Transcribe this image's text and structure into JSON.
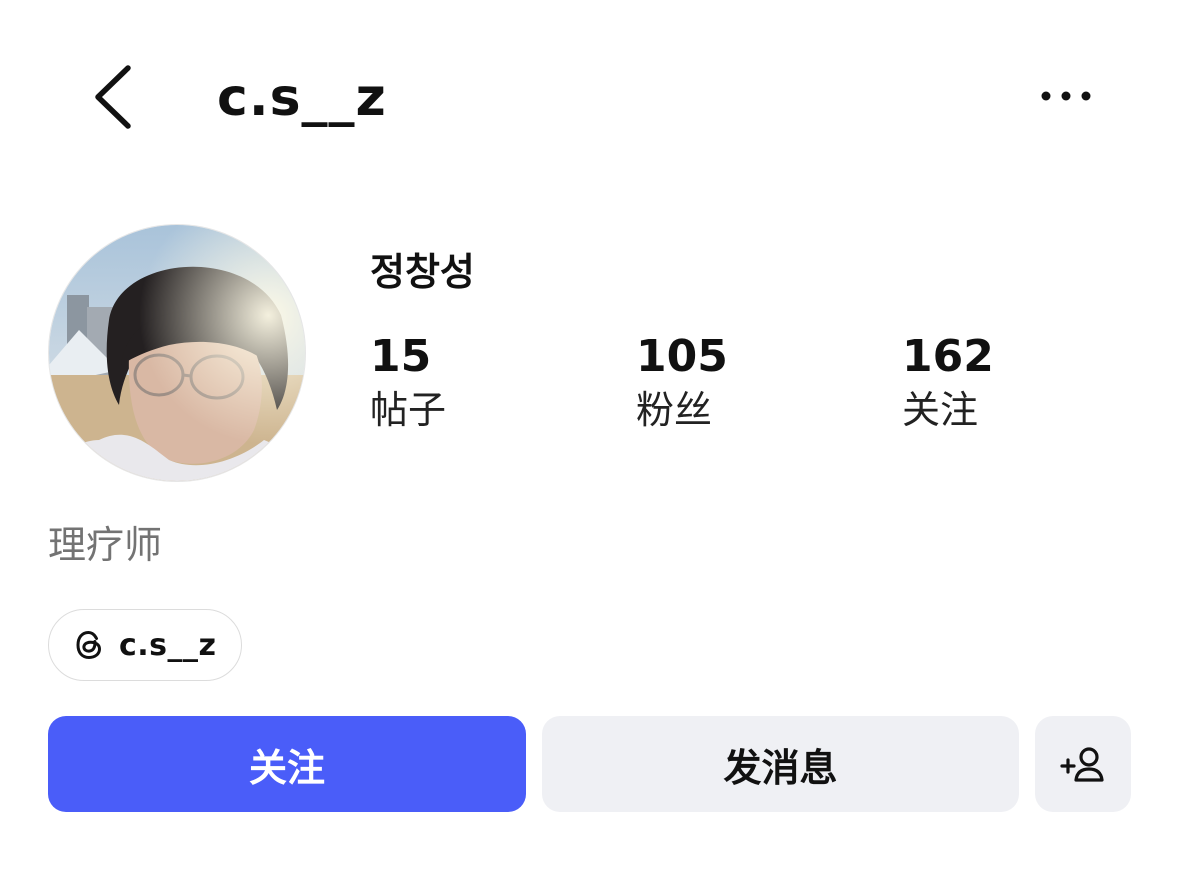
{
  "header": {
    "username": "c.s__z",
    "back_icon": "chevron-left-icon",
    "more_icon": "more-horizontal-icon"
  },
  "profile": {
    "display_name": "정창성",
    "avatar": "profile-photo"
  },
  "stats": {
    "posts": {
      "value": "15",
      "label": "帖子"
    },
    "followers": {
      "value": "105",
      "label": "粉丝"
    },
    "following": {
      "value": "162",
      "label": "关注"
    }
  },
  "bio": "理疗师",
  "threads_link": {
    "icon": "threads-icon",
    "label": "c.s__z"
  },
  "actions": {
    "follow_label": "关注",
    "message_label": "发消息",
    "add_user_icon": "add-person-icon"
  },
  "colors": {
    "primary": "#4a5df9",
    "secondary_button": "#eff0f4",
    "muted_text": "#737373"
  }
}
